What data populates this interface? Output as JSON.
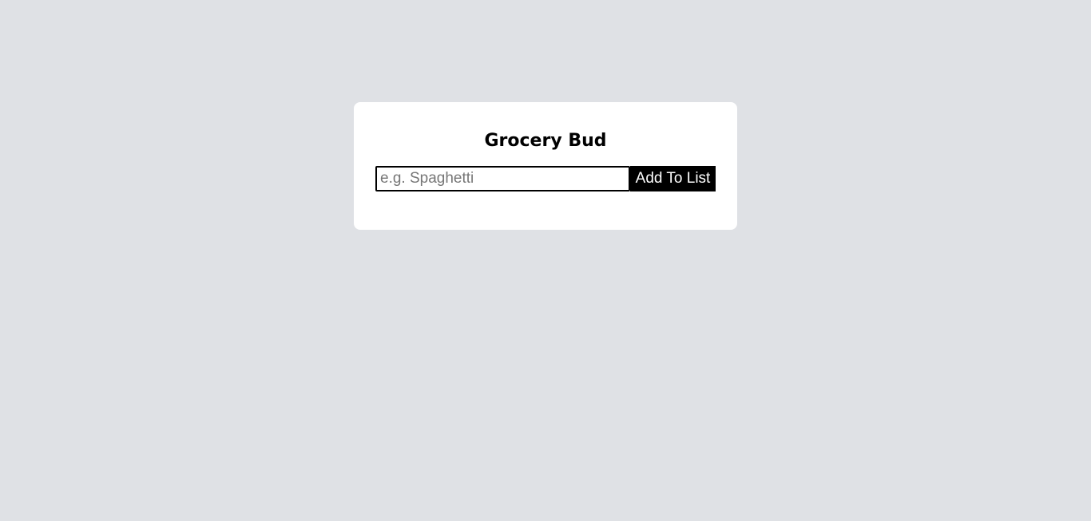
{
  "app": {
    "title": "Grocery Bud"
  },
  "form": {
    "input_value": "",
    "input_placeholder": "e.g. Spaghetti",
    "add_label": "Add To List"
  },
  "colors": {
    "page_background": "#dfe1e5",
    "card_background": "#ffffff",
    "button_background": "#000000",
    "button_text": "#ffffff"
  }
}
